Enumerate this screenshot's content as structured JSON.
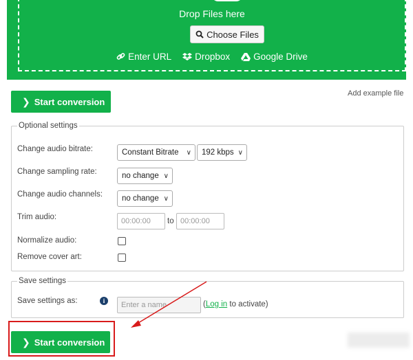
{
  "dropzone": {
    "drop_text": "Drop Files here",
    "choose_label": "Choose Files",
    "sources": [
      {
        "icon": "link-icon",
        "label": "Enter URL"
      },
      {
        "icon": "dropbox-icon",
        "label": "Dropbox"
      },
      {
        "icon": "google-drive-icon",
        "label": "Google Drive"
      }
    ]
  },
  "start_button_label": "Start conversion",
  "add_example_label": "Add example file",
  "optional_settings": {
    "legend": "Optional settings",
    "bitrate_label": "Change audio bitrate:",
    "bitrate_mode": "Constant Bitrate",
    "bitrate_value": "192 kbps",
    "sampling_label": "Change sampling rate:",
    "sampling_value": "no change",
    "channels_label": "Change audio channels:",
    "channels_value": "no change",
    "trim_label": "Trim audio:",
    "trim_from_placeholder": "00:00:00",
    "trim_to_word": "to",
    "trim_to_placeholder": "00:00:00",
    "normalize_label": "Normalize audio:",
    "remove_cover_label": "Remove cover art:"
  },
  "save_settings": {
    "legend": "Save settings",
    "save_as_label": "Save settings as:",
    "name_placeholder": "Enter a name",
    "login_open": "(",
    "login_link": "Log in",
    "login_rest": " to activate)"
  },
  "colors": {
    "accent_green": "#12b14a",
    "highlight_red": "#d81a1a"
  }
}
